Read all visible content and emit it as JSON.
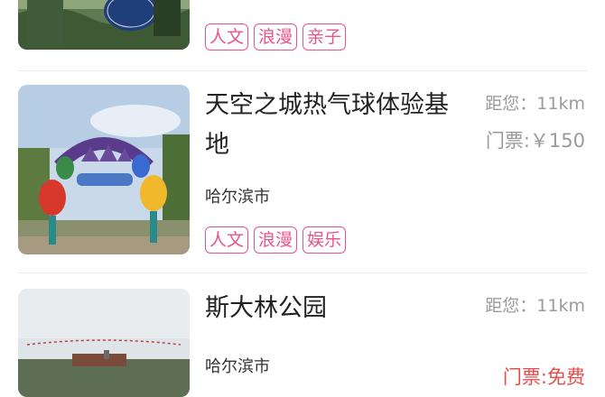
{
  "list": {
    "items": [
      {
        "title": "",
        "city": "",
        "tags": [
          "人文",
          "浪漫",
          "亲子"
        ],
        "distance": "",
        "price": ""
      },
      {
        "title": "天空之城热气球体验基地",
        "city": "哈尔滨市",
        "tags": [
          "人文",
          "浪漫",
          "娱乐"
        ],
        "distance": "距您：11km",
        "price": "门票:￥150"
      },
      {
        "title": "斯大林公园",
        "city": "哈尔滨市",
        "tags": [],
        "distance": "距您：11km",
        "price": "门票:免费"
      }
    ]
  },
  "colors": {
    "tag_accent": "#e8538a",
    "free_price": "#e84b4b",
    "muted_text": "#9a9a9a"
  }
}
